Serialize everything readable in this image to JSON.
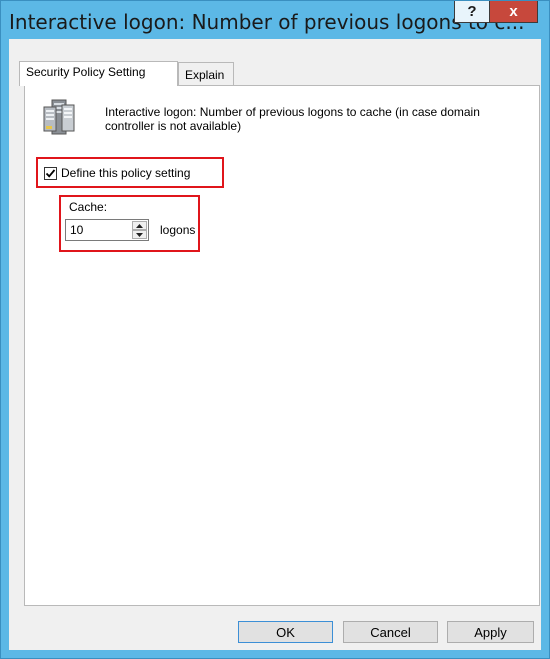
{
  "window": {
    "title": "Interactive logon: Number of previous logons to c...",
    "help_label": "?",
    "close_label": "x"
  },
  "tabs": [
    {
      "label": "Security Policy Setting",
      "active": true
    },
    {
      "label": "Explain",
      "active": false
    }
  ],
  "policy": {
    "icon": "server-icon",
    "description": "Interactive logon: Number of previous logons to cache (in case domain controller is not available)",
    "define_label": "Define this policy setting",
    "define_checked": true,
    "cache_label": "Cache:",
    "cache_value": "10",
    "unit_label": "logons"
  },
  "buttons": {
    "ok": "OK",
    "cancel": "Cancel",
    "apply": "Apply"
  },
  "colors": {
    "titlebar": "#5cb8e6",
    "close": "#c7483c",
    "highlight": "#e0151b"
  }
}
